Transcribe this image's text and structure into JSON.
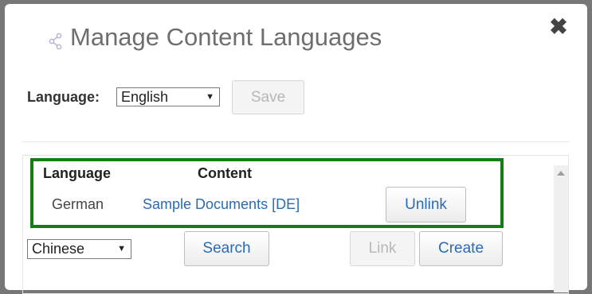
{
  "dialog": {
    "title": "Manage Content Languages",
    "close_label": "✖"
  },
  "language_select": {
    "label": "Language:",
    "value": "English",
    "save_label": "Save"
  },
  "table": {
    "headers": [
      "Language",
      "Content"
    ],
    "rows": [
      {
        "language": "German",
        "content": "Sample Documents [DE]",
        "action": "Unlink"
      }
    ]
  },
  "add_row": {
    "language_value": "Chinese",
    "search_label": "Search",
    "link_label": "Link",
    "create_label": "Create"
  },
  "colors": {
    "accent": "#2a6bb5",
    "highlight_border": "#167c16"
  }
}
